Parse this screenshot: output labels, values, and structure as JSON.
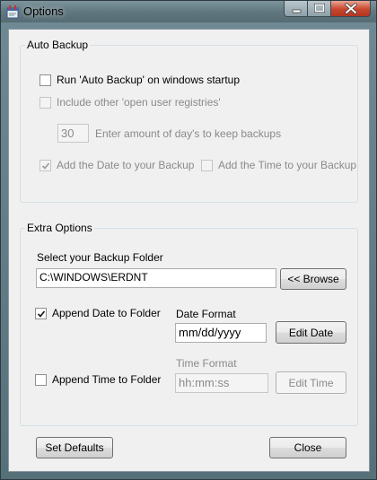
{
  "window": {
    "title": "Options",
    "min_glyph": "—",
    "max_glyph": "□",
    "close_glyph": "✕"
  },
  "auto_backup": {
    "legend": "Auto Backup",
    "run_on_startup": {
      "label": "Run 'Auto Backup' on windows startup",
      "checked": false,
      "enabled": true
    },
    "include_registries": {
      "label": "Include other 'open user registries'",
      "checked": false,
      "enabled": false
    },
    "days_value": "30",
    "days_label": "Enter amount of day's to keep backups",
    "add_date": {
      "label": "Add the Date to your Backup",
      "checked": true,
      "enabled": false
    },
    "add_time": {
      "label": "Add the Time to your Backup",
      "checked": false,
      "enabled": false
    }
  },
  "extra_options": {
    "legend": "Extra Options",
    "folder_label": "Select your Backup Folder",
    "folder_value": "C:\\WINDOWS\\ERDNT",
    "browse_label": "<< Browse",
    "append_date": {
      "label": "Append Date to Folder",
      "checked": true
    },
    "date_format_label": "Date Format",
    "date_format_value": "mm/dd/yyyy",
    "edit_date_label": "Edit Date",
    "append_time": {
      "label": "Append Time to Folder",
      "checked": false
    },
    "time_format_label": "Time Format",
    "time_format_value": "hh:mm:ss",
    "edit_time_label": "Edit Time"
  },
  "footer": {
    "set_defaults_label": "Set Defaults",
    "close_label": "Close"
  },
  "colors": {
    "titlebar": "#617880",
    "close_button": "#c8452e",
    "dialog_bg": "#f0f0f0",
    "disabled_text": "#8a8a8a"
  }
}
